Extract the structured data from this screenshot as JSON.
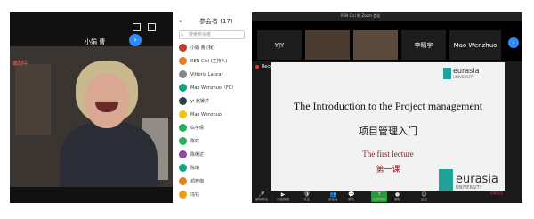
{
  "phone": {
    "name": "小娟 曹",
    "status": "录制中",
    "next_label": "›"
  },
  "participants": {
    "collapse": "⌄",
    "title": "参会者 (17)",
    "search_placeholder": "搜索参会者",
    "list": [
      {
        "name": "小娟 曹 (我)",
        "color": "#c0392b"
      },
      {
        "name": "REN Cici (主持人)",
        "color": "#e67e22"
      },
      {
        "name": "Vittoria Lancar",
        "color": "#7f8c8d"
      },
      {
        "name": "Mao Wenzhuo（FC）",
        "color": "#16a085"
      },
      {
        "name": "yi 赵媛芹",
        "color": "#2c3e50"
      },
      {
        "name": "Mao Wenzhuo",
        "color": "#f1c40f"
      },
      {
        "name": "白芋倩",
        "color": "#27ae60"
      },
      {
        "name": "陈欢",
        "color": "#27ae60"
      },
      {
        "name": "陈俐达",
        "color": "#8e44ad"
      },
      {
        "name": "陈瑞",
        "color": "#16a085"
      },
      {
        "name": "邓梓伽",
        "color": "#e67e22"
      },
      {
        "name": "冯钰",
        "color": "#f39c12"
      }
    ]
  },
  "zoom": {
    "title": "REN Cici 的 Zoom 会议",
    "strip": [
      "YJY",
      "",
      "",
      "李晴宇",
      "Mao Wenzhuo"
    ],
    "strip_arrow": "›",
    "recording": "Recording"
  },
  "slide": {
    "logo_word": "eurasia",
    "logo_sub": "UNIVERSITY",
    "title": "The Introduction to the Project management",
    "subtitle": "项目管理入门",
    "lecture": "The first lecture",
    "lecture_cn": "第一课"
  },
  "toolbar": [
    {
      "glyph": "🎤",
      "label": "解除静音"
    },
    {
      "glyph": "▶",
      "label": "开启视频"
    },
    {
      "glyph": "🛡",
      "label": "安全"
    },
    {
      "glyph": "👥",
      "label": "参会者"
    },
    {
      "glyph": "💬",
      "label": "聊天"
    },
    {
      "glyph": "↑",
      "label": "共享屏幕"
    },
    {
      "glyph": "●",
      "label": "录制"
    },
    {
      "glyph": "☺",
      "label": "反应"
    },
    {
      "glyph": "",
      "label": "结束会议"
    }
  ]
}
